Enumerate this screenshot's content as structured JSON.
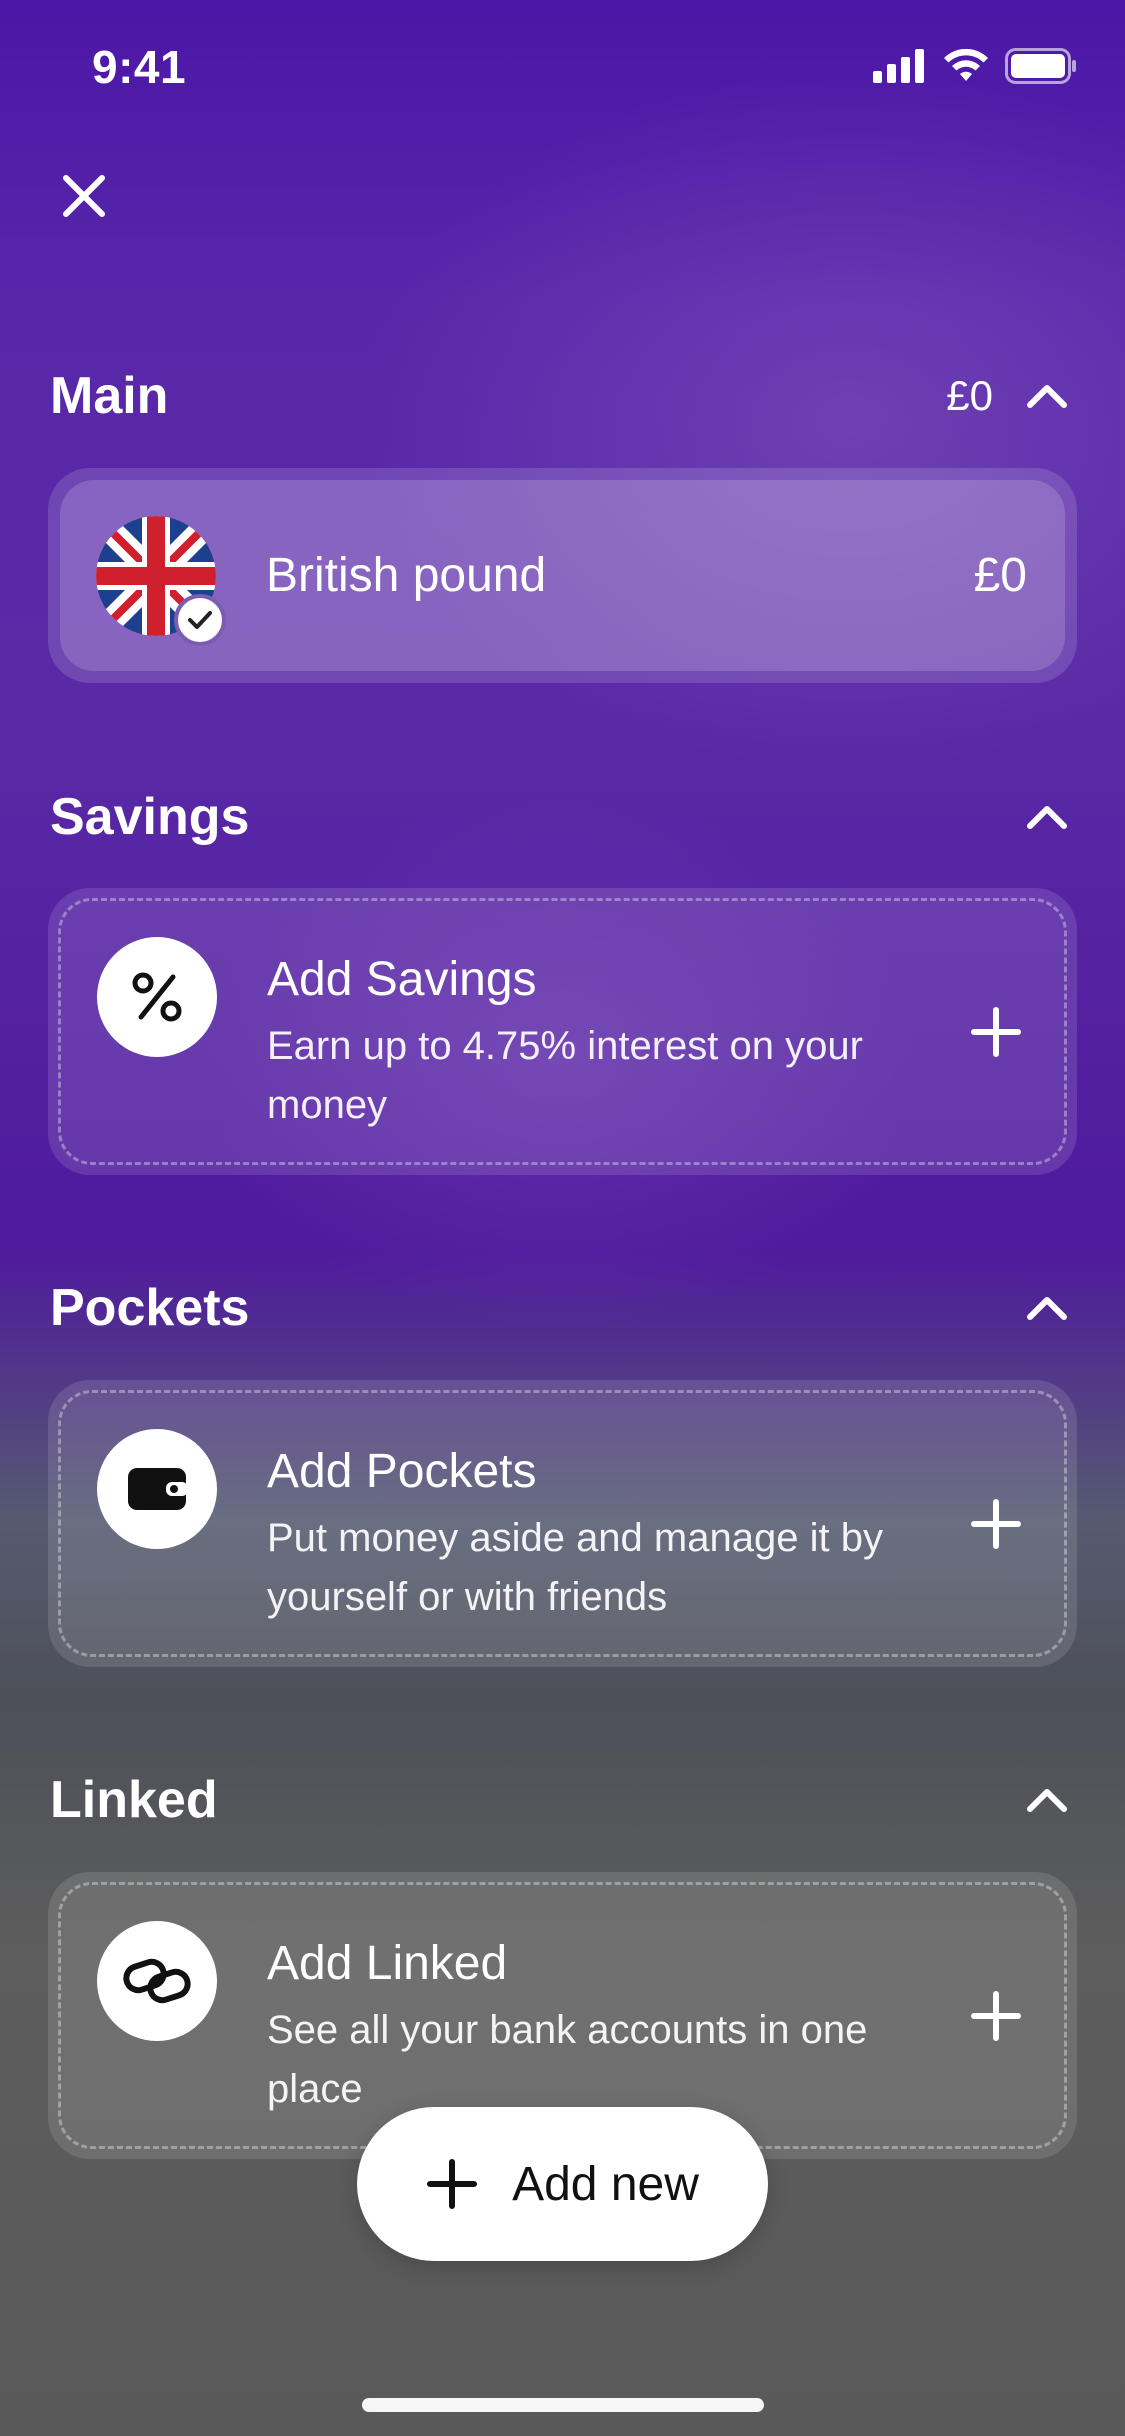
{
  "status_bar": {
    "time": "9:41"
  },
  "sections": {
    "main": {
      "title": "Main",
      "amount": "£0",
      "account": {
        "label": "British pound",
        "value": "£0"
      }
    },
    "savings": {
      "title": "Savings",
      "card": {
        "title": "Add Savings",
        "description": "Earn up to 4.75% interest on your money"
      }
    },
    "pockets": {
      "title": "Pockets",
      "card": {
        "title": "Add Pockets",
        "description": "Put money aside and manage it by yourself or with friends"
      }
    },
    "linked": {
      "title": "Linked",
      "card": {
        "title": "Add Linked",
        "description": "See all your bank accounts in one place"
      }
    }
  },
  "add_new": {
    "label": "Add new"
  },
  "icons": {
    "close": "close-icon",
    "chevron": "chevron-up-icon",
    "plus": "plus-icon",
    "savings": "percent-icon",
    "pockets": "wallet-icon",
    "linked": "link-icon",
    "flag": "uk-flag-icon",
    "check": "check-icon"
  },
  "colors": {
    "background_top": "#4b16a6",
    "background_bottom": "#595959",
    "button_bg": "#ffffff"
  }
}
